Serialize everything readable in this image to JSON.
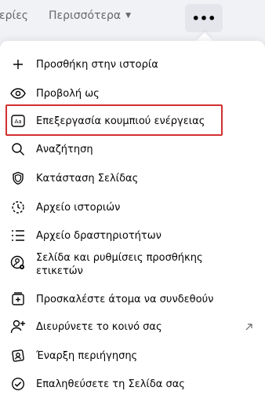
{
  "topbar": {
    "partial_tab": "ερίες",
    "more_label": "Περισσότερα",
    "more_caret": "▼",
    "dots_label": "•••"
  },
  "menu": {
    "items": [
      {
        "label": "Προσθήκη στην ιστορία",
        "icon": "plus-icon"
      },
      {
        "label": "Προβολή ως",
        "icon": "eye-icon"
      },
      {
        "label": "Επεξεργασία κουμπιού ενέργειας",
        "icon": "action-button-icon",
        "highlighted": true
      },
      {
        "label": "Αναζήτηση",
        "icon": "search-icon"
      },
      {
        "label": "Κατάσταση Σελίδας",
        "icon": "shield-icon"
      },
      {
        "label": "Αρχείο ιστοριών",
        "icon": "story-archive-icon"
      },
      {
        "label": "Αρχείο δραστηριοτήτων",
        "icon": "list-icon"
      },
      {
        "label": "Σελίδα και ρυθμίσεις προσθήκης ετικετών",
        "icon": "tag-settings-icon"
      },
      {
        "label": "Προσκαλέστε άτομα να συνδεθούν",
        "icon": "invite-icon"
      },
      {
        "label": "Διευρύνετε το κοινό σας",
        "icon": "add-person-icon",
        "external_icon": "external-link-icon"
      },
      {
        "label": "Έναρξη περιήγησης",
        "icon": "tour-icon"
      },
      {
        "label": "Επαληθεύσετε τη Σελίδα σας",
        "icon": "verify-icon"
      }
    ]
  },
  "colors": {
    "highlight_border": "#d32f2f",
    "text": "#050505",
    "muted": "#65676b"
  }
}
